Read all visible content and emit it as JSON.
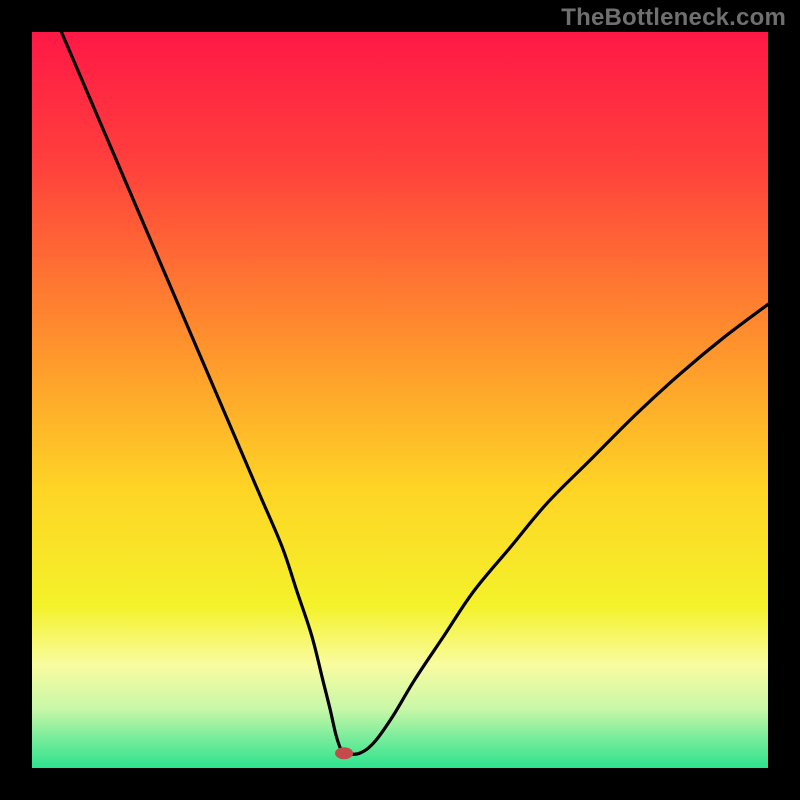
{
  "watermark": "TheBottleneck.com",
  "chart_data": {
    "type": "line",
    "title": "",
    "xlabel": "",
    "ylabel": "",
    "xlim": [
      0,
      100
    ],
    "ylim": [
      0,
      100
    ],
    "grid": false,
    "legend": false,
    "background_gradient_stops": [
      {
        "offset": 0.0,
        "color": "#ff1846"
      },
      {
        "offset": 0.18,
        "color": "#ff403c"
      },
      {
        "offset": 0.4,
        "color": "#ff8a2e"
      },
      {
        "offset": 0.62,
        "color": "#fed425"
      },
      {
        "offset": 0.78,
        "color": "#f4f22a"
      },
      {
        "offset": 0.86,
        "color": "#f9fca0"
      },
      {
        "offset": 0.92,
        "color": "#c8f7a8"
      },
      {
        "offset": 0.96,
        "color": "#77ec9a"
      },
      {
        "offset": 1.0,
        "color": "#2de38f"
      }
    ],
    "series": [
      {
        "name": "bottleneck-curve",
        "x": [
          4,
          7,
          10,
          13,
          16,
          19,
          22,
          25,
          28,
          31,
          34,
          36,
          38,
          39.5,
          40.5,
          41.3,
          42,
          42.8,
          44.5,
          46.5,
          49,
          52,
          56,
          60,
          65,
          70,
          76,
          82,
          88,
          94,
          100
        ],
        "values": [
          100,
          93,
          86,
          79,
          72,
          65,
          58,
          51,
          44,
          37,
          30,
          24,
          18,
          12,
          8,
          4.5,
          2.5,
          2,
          2,
          3.5,
          7,
          12,
          18,
          24,
          30,
          36,
          42,
          48,
          53.5,
          58.5,
          63
        ]
      }
    ],
    "marker": {
      "name": "minimum-marker",
      "x": 42.4,
      "y": 2.0,
      "color": "#c54a4a",
      "rx": 9,
      "ry": 6
    }
  }
}
